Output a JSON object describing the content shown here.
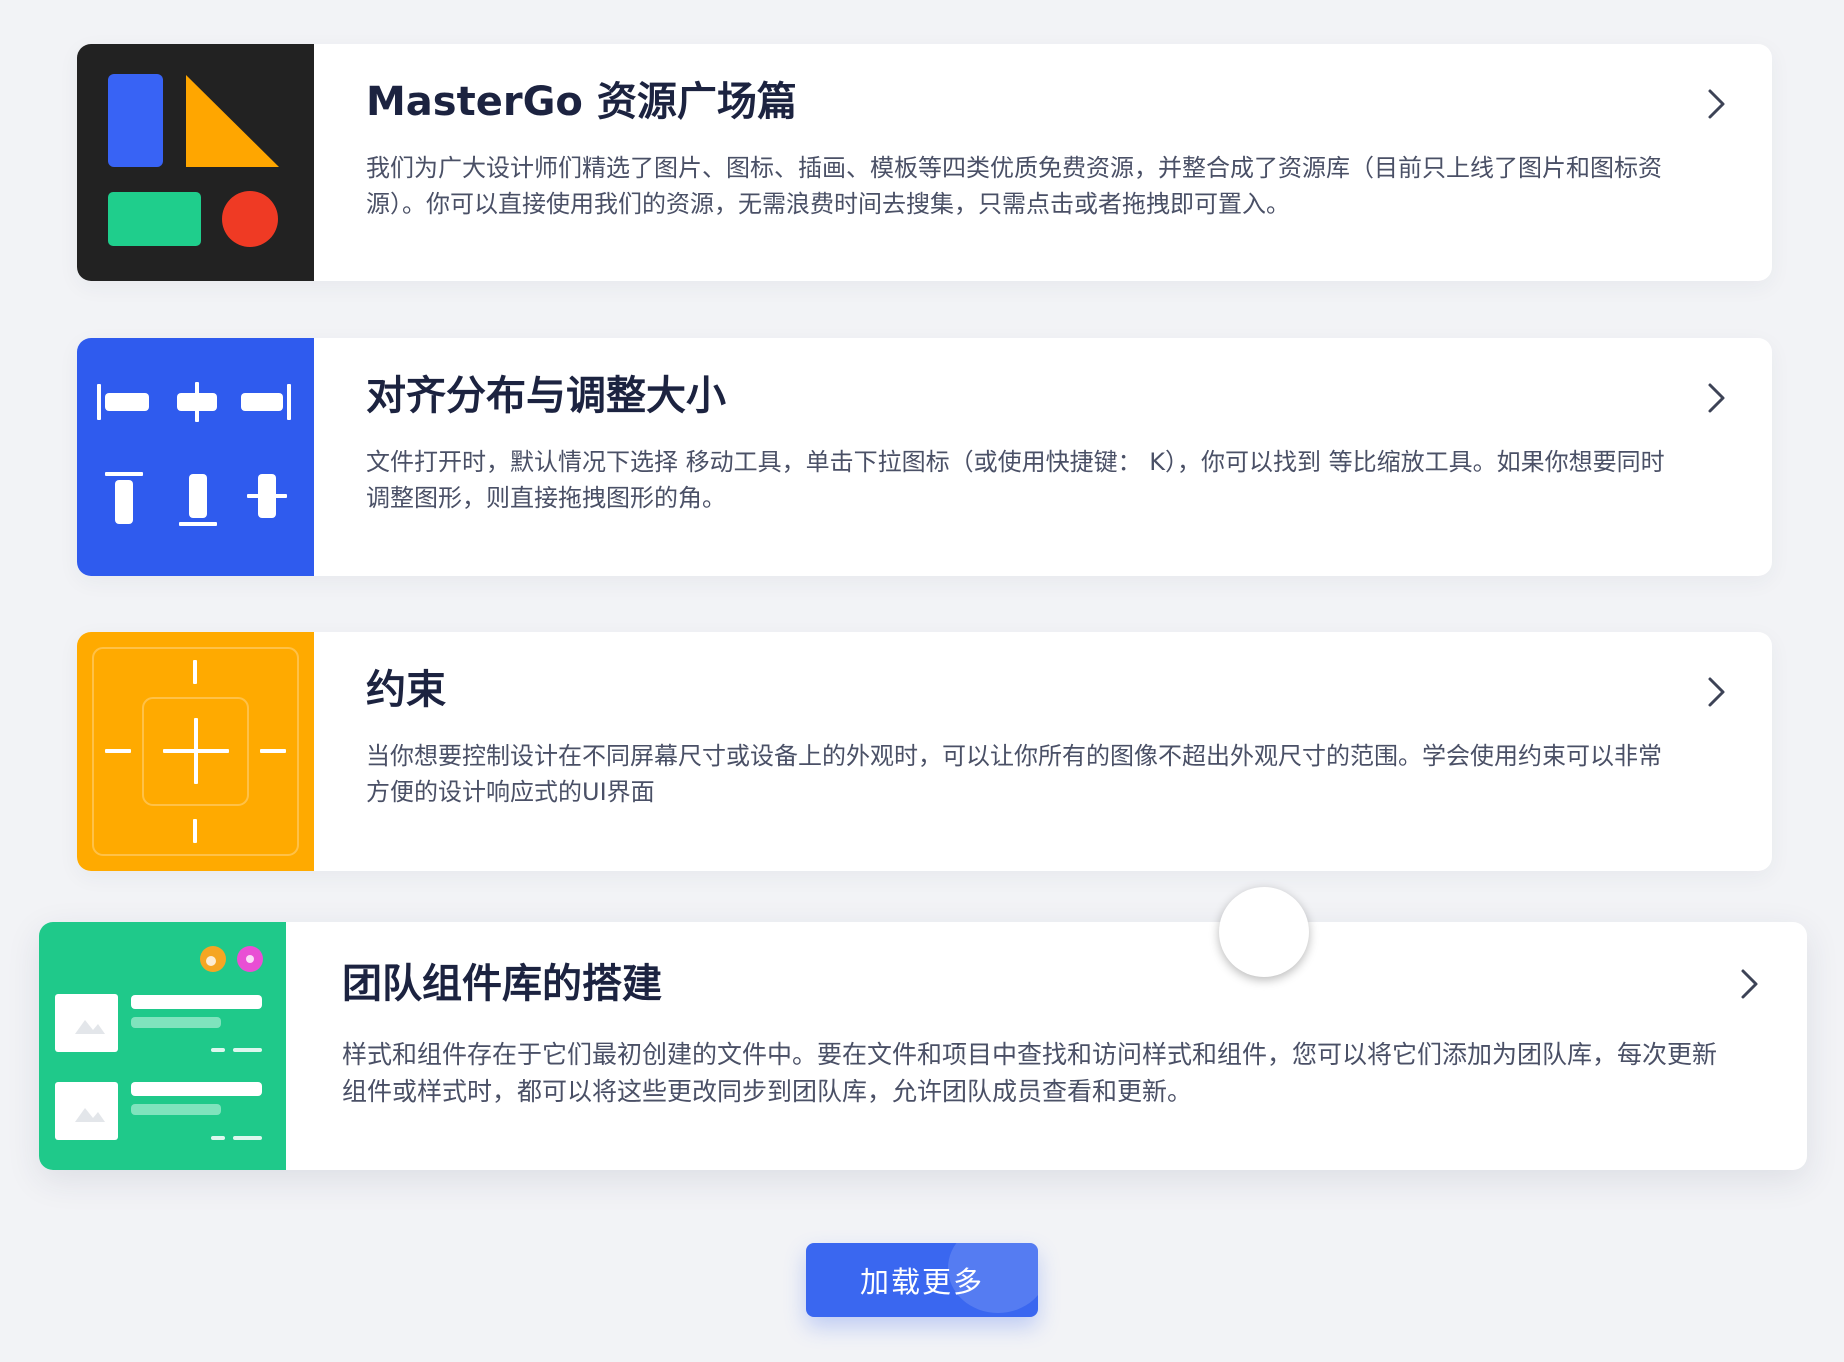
{
  "cards": [
    {
      "title": "MasterGo 资源广场篇",
      "description": "我们为广大设计师们精选了图片、图标、插画、模板等四类优质免费资源，并整合成了资源库（目前只上线了图片和图标资源）。你可以直接使用我们的资源，无需浪费时间去搜集，只需点击或者拖拽即可置入。",
      "thumbnail_icon": "shapes-icon",
      "thumbnail_color": "#222222"
    },
    {
      "title": "对齐分布与调整大小",
      "description": "文件打开时，默认情况下选择 移动工具，单击下拉图标（或使用快捷键： K），你可以找到 等比缩放工具。如果你想要同时调整图形，则直接拖拽图形的角。",
      "thumbnail_icon": "align-distribute-icon",
      "thumbnail_color": "#2f5bee"
    },
    {
      "title": "约束",
      "description": "当你想要控制设计在不同屏幕尺寸或设备上的外观时，可以让你所有的图像不超出外观尺寸的范围。学会使用约束可以非常方便的设计响应式的UI界面",
      "thumbnail_icon": "constraints-icon",
      "thumbnail_color": "#ffaa00"
    },
    {
      "title": "团队组件库的搭建",
      "description": "样式和组件存在于它们最初创建的文件中。要在文件和项目中查找和访问样式和组件，您可以将它们添加为团队库，每次更新组件或样式时，都可以将这些更改同步到团队库，允许团队成员查看和更新。",
      "thumbnail_icon": "team-library-icon",
      "thumbnail_color": "#1fc98a"
    }
  ],
  "load_more_label": "加载更多",
  "colors": {
    "page_background": "#f2f3f6",
    "title_text": "#1c2340",
    "body_text": "#4a5066",
    "primary_button": "#3a67f0"
  }
}
